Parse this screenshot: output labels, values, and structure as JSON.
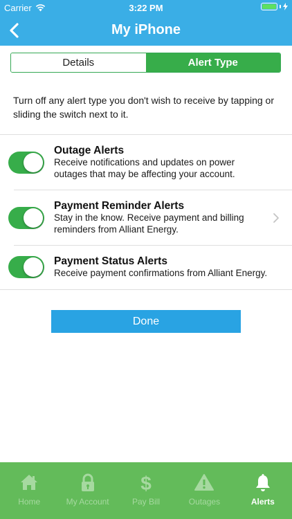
{
  "status_bar": {
    "carrier": "Carrier",
    "time": "3:22 PM"
  },
  "nav": {
    "title": "My iPhone",
    "back_icon": "chevron-left-icon"
  },
  "segmented": {
    "details": "Details",
    "alert_type": "Alert Type",
    "selected": "alert_type"
  },
  "intro": "Turn off any alert type you don't wish to receive by tapping or sliding the switch next to it.",
  "alerts": [
    {
      "title": "Outage Alerts",
      "line1": "Receive notifications and updates on power",
      "line2": "outages that may be affecting your account.",
      "enabled": true,
      "has_chevron": false
    },
    {
      "title": "Payment Reminder Alerts",
      "line1": "Stay in the know. Receive payment and billing",
      "line2": "reminders from Alliant Energy.",
      "enabled": true,
      "has_chevron": true
    },
    {
      "title": "Payment Status Alerts",
      "line1": "Receive payment confirmations from Alliant Energy.",
      "line2": "",
      "enabled": true,
      "has_chevron": false
    }
  ],
  "done_label": "Done",
  "tabs": [
    {
      "label": "Home",
      "icon": "home-icon",
      "active": false
    },
    {
      "label": "My Account",
      "icon": "lock-icon",
      "active": false
    },
    {
      "label": "Pay Bill",
      "icon": "dollar-icon",
      "active": false
    },
    {
      "label": "Outages",
      "icon": "warning-icon",
      "active": false
    },
    {
      "label": "Alerts",
      "icon": "bell-icon",
      "active": true
    }
  ],
  "colors": {
    "header": "#3aaee6",
    "green": "#37ad4a",
    "tabbar": "#63bb5a",
    "done": "#29a3e3"
  }
}
